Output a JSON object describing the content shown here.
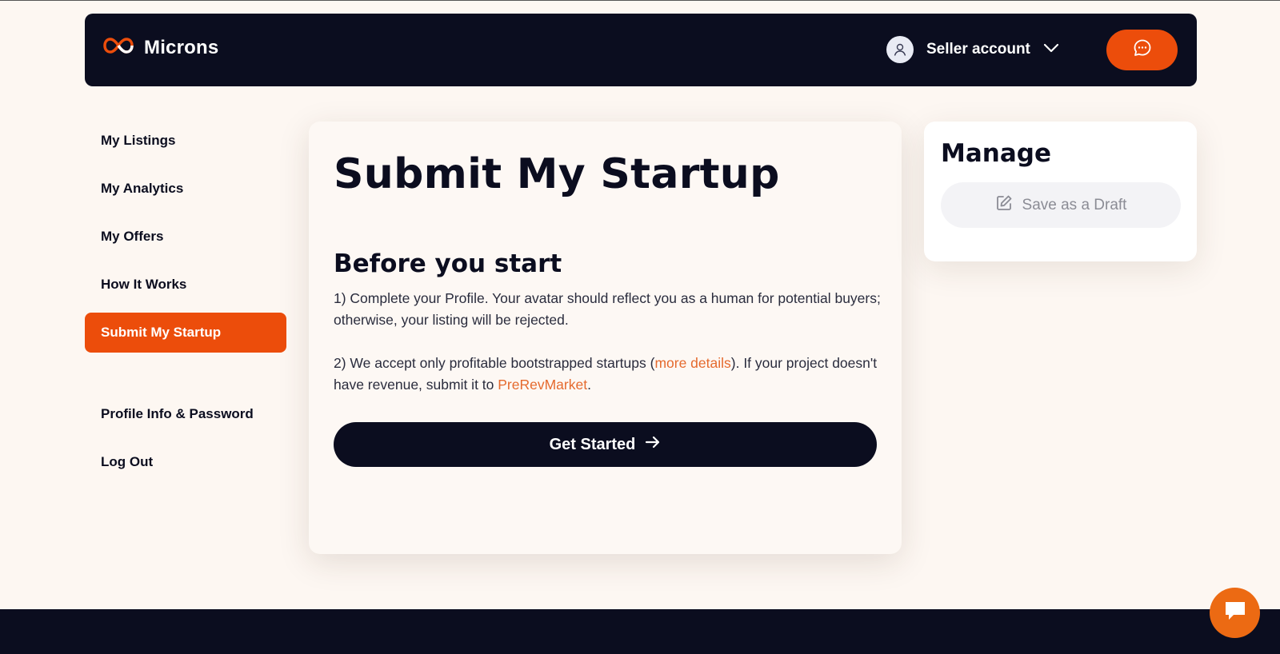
{
  "header": {
    "brand": "Microns",
    "account_label": "Seller account",
    "icons": {
      "logo": "infinity-logo-icon",
      "avatar": "user-icon",
      "dropdown": "chevron-down-icon",
      "chat": "chat-bubble-icon"
    }
  },
  "sidebar": {
    "items": [
      {
        "label": "My Listings"
      },
      {
        "label": "My Analytics"
      },
      {
        "label": "My Offers"
      },
      {
        "label": "How It Works"
      },
      {
        "label": "Submit My Startup",
        "active": true
      },
      {
        "label": "Profile Info & Password"
      },
      {
        "label": "Log Out"
      }
    ]
  },
  "main": {
    "title": "Submit My Startup",
    "section_title": "Before you start",
    "para1": "1) Complete your Profile. Your avatar should reflect you as a human for potential buyers; otherwise, your listing will be rejected.",
    "para2_prefix": "2) We accept only profitable bootstrapped startups (",
    "para2_link1": "more details",
    "para2_middle": "). If your project doesn't have revenue, submit it to ",
    "para2_link2": "PreRevMarket",
    "para2_suffix": ".",
    "cta_label": "Get Started",
    "cta_icon": "arrow-right-icon"
  },
  "manage": {
    "title": "Manage",
    "draft_label": "Save as a Draft",
    "draft_icon": "edit-icon"
  },
  "colors": {
    "accent": "#ec4d0b",
    "dark": "#0b0d1f",
    "background": "#fdf7f2",
    "link": "#e56a2e"
  }
}
